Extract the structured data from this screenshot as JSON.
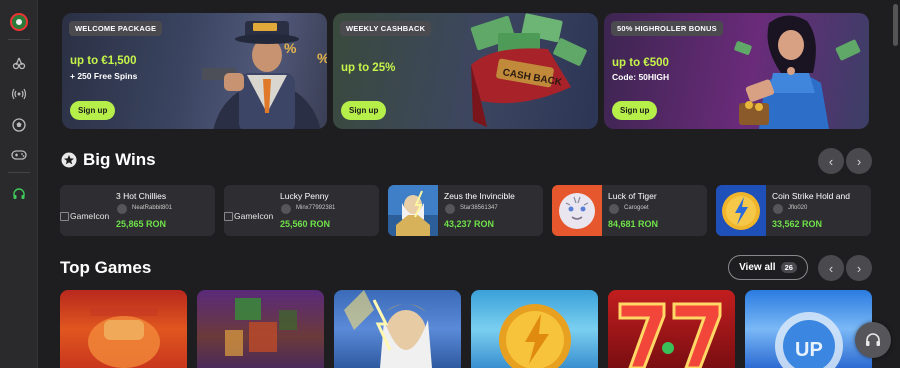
{
  "sidebar": {
    "logo_icon": "roulette-logo-icon",
    "items": [
      {
        "icon": "cherries-icon",
        "glyph": "🍒"
      },
      {
        "icon": "live-broadcast-icon",
        "glyph": "((•))"
      },
      {
        "icon": "soccer-ball-icon",
        "glyph": "⚽"
      },
      {
        "icon": "gamepad-icon",
        "glyph": "🎮"
      },
      {
        "icon": "headset-support-icon",
        "glyph": "🎧"
      }
    ]
  },
  "promos": [
    {
      "tag": "WELCOME PACKAGE",
      "headline": "up to €1,500",
      "sub": "+ 250 Free Spins",
      "button": "Sign up"
    },
    {
      "tag": "WEEKLY CASHBACK",
      "headline": "up to 25%",
      "sub": "",
      "button": "Sign up"
    },
    {
      "tag": "50% HIGHROLLER BONUS",
      "headline": "up to €500",
      "sub": "Code: 50HIGH",
      "button": "Sign up"
    }
  ],
  "big_wins": {
    "title": "Big Wins",
    "items": [
      {
        "game": "3 Hot Chillies",
        "user": "NeatRabbit801",
        "amount": "25,865 RON",
        "thumb_alt": "GameIcon"
      },
      {
        "game": "Lucky Penny",
        "user": "Minx77992381",
        "amount": "25,560 RON",
        "thumb_alt": "GameIcon"
      },
      {
        "game": "Zeus the Invincible",
        "user": "Star38561347",
        "amount": "43,237 RON",
        "thumb_alt": ""
      },
      {
        "game": "Luck of Tiger",
        "user": "Carogoet",
        "amount": "84,681 RON",
        "thumb_alt": ""
      },
      {
        "game": "Coin Strike Hold and",
        "user": "Jflo020",
        "amount": "33,562 RON",
        "thumb_alt": ""
      }
    ]
  },
  "top_games": {
    "title": "Top Games",
    "view_all_label": "View all",
    "view_all_count": "26"
  },
  "nav": {
    "prev": "‹",
    "next": "›"
  },
  "colors": {
    "accent": "#b6ef4a",
    "win_amount": "#6fe04a",
    "background": "#1e1e20"
  }
}
